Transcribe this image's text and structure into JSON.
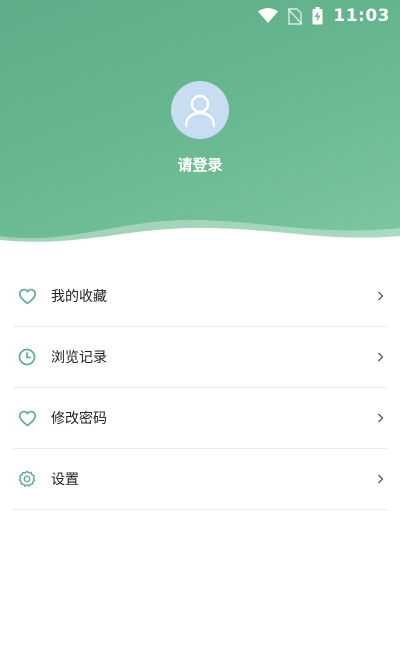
{
  "status_bar": {
    "time": "11:03",
    "icons": [
      "wifi-icon",
      "no-sim-icon",
      "battery-charging-icon"
    ]
  },
  "profile": {
    "login_text": "请登录",
    "avatar_icon": "user-icon"
  },
  "menu": {
    "items": [
      {
        "label": "我的收藏",
        "icon": "heart-icon"
      },
      {
        "label": "浏览记录",
        "icon": "clock-icon"
      },
      {
        "label": "修改密码",
        "icon": "heart-icon"
      },
      {
        "label": "设置",
        "icon": "gear-icon"
      }
    ]
  },
  "colors": {
    "header_green": "#66b68f",
    "icon_green": "#5fae8a",
    "avatar_bg": "#c9ddf2",
    "divider": "#ececec"
  }
}
